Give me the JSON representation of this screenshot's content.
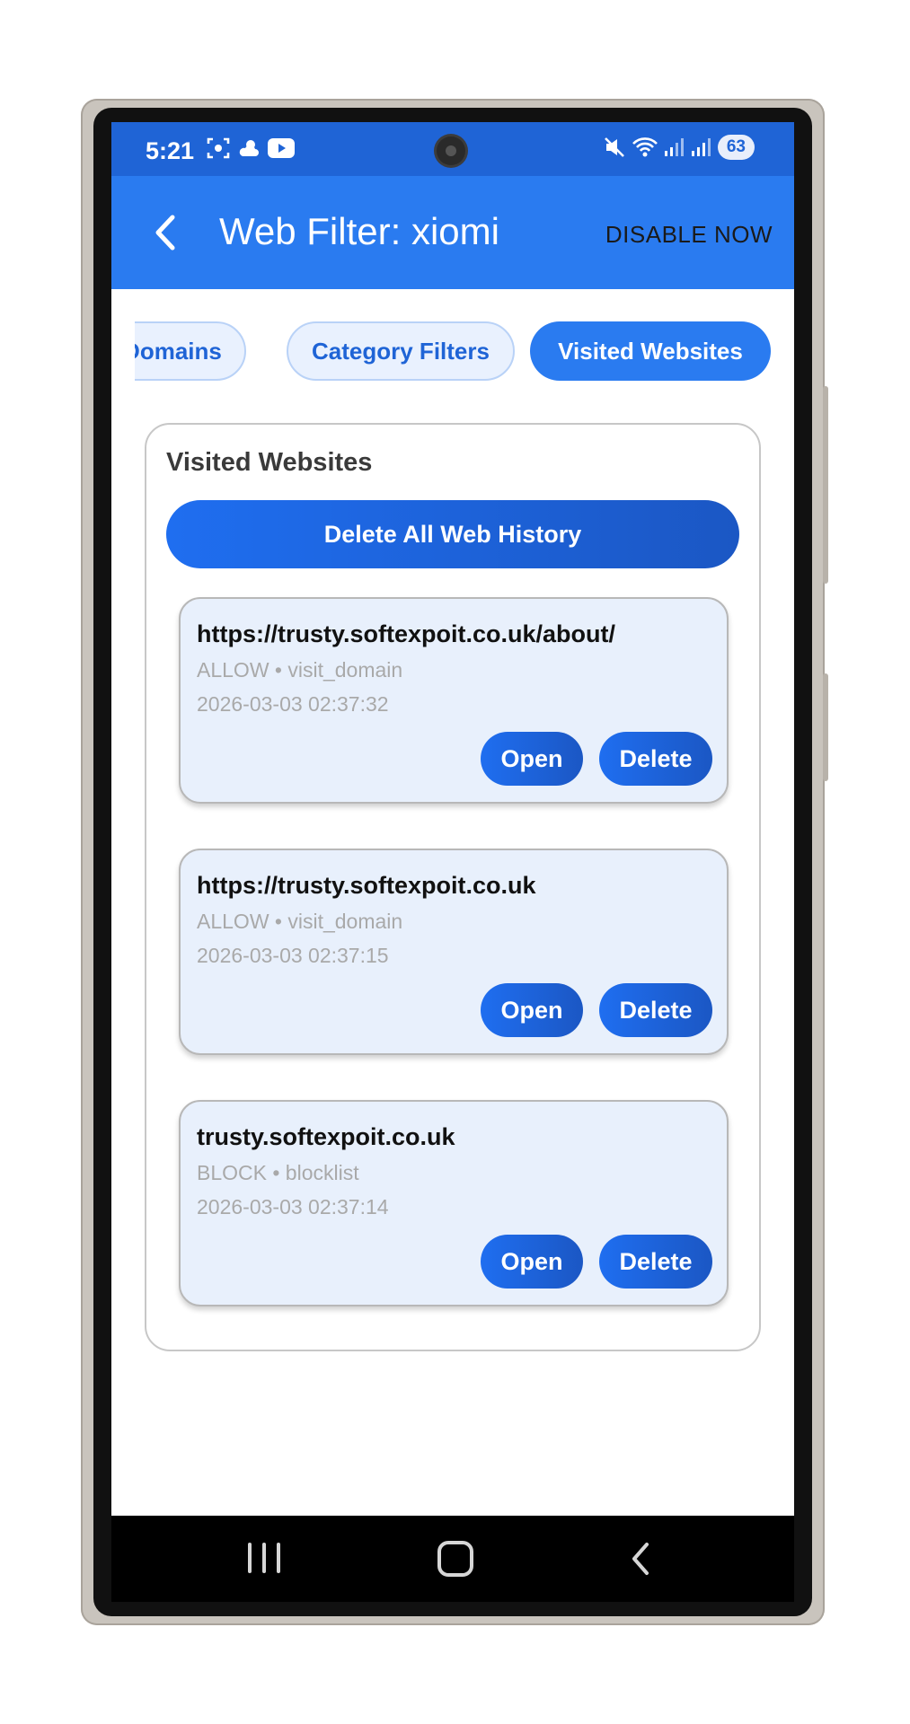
{
  "status_bar": {
    "time": "5:21",
    "left_icons": [
      "screenshot-icon",
      "weather-icon",
      "youtube-icon"
    ],
    "right_icons": [
      "mute-icon",
      "wifi-icon",
      "signal-icon",
      "signal-icon"
    ],
    "battery": "63"
  },
  "app_bar": {
    "back_icon": "chevron-left-icon",
    "title": "Web Filter: xiomi",
    "action_label": "DISABLE NOW"
  },
  "tabs": [
    {
      "label": "t Domains",
      "active": false
    },
    {
      "label": "Category Filters",
      "active": false
    },
    {
      "label": "Visited Websites",
      "active": true
    }
  ],
  "section": {
    "title": "Visited Websites",
    "delete_all_label": "Delete All Web History"
  },
  "entries": [
    {
      "url": "https://trusty.softexpoit.co.uk/about/",
      "meta": "ALLOW • visit_domain",
      "time": "2026-03-03 02:37:32",
      "open_label": "Open",
      "delete_label": "Delete"
    },
    {
      "url": "https://trusty.softexpoit.co.uk",
      "meta": "ALLOW • visit_domain",
      "time": "2026-03-03 02:37:15",
      "open_label": "Open",
      "delete_label": "Delete"
    },
    {
      "url": "trusty.softexpoit.co.uk",
      "meta": "BLOCK • blocklist",
      "time": "2026-03-03 02:37:14",
      "open_label": "Open",
      "delete_label": "Delete"
    }
  ],
  "nav_bar": {
    "icons": [
      "recents-icon",
      "home-icon",
      "back-icon"
    ]
  },
  "colors": {
    "primary": "#2a7bf0",
    "status_bar": "#1f64d6",
    "card_bg": "#e8f0fc",
    "muted_text": "#a9a9a9"
  }
}
